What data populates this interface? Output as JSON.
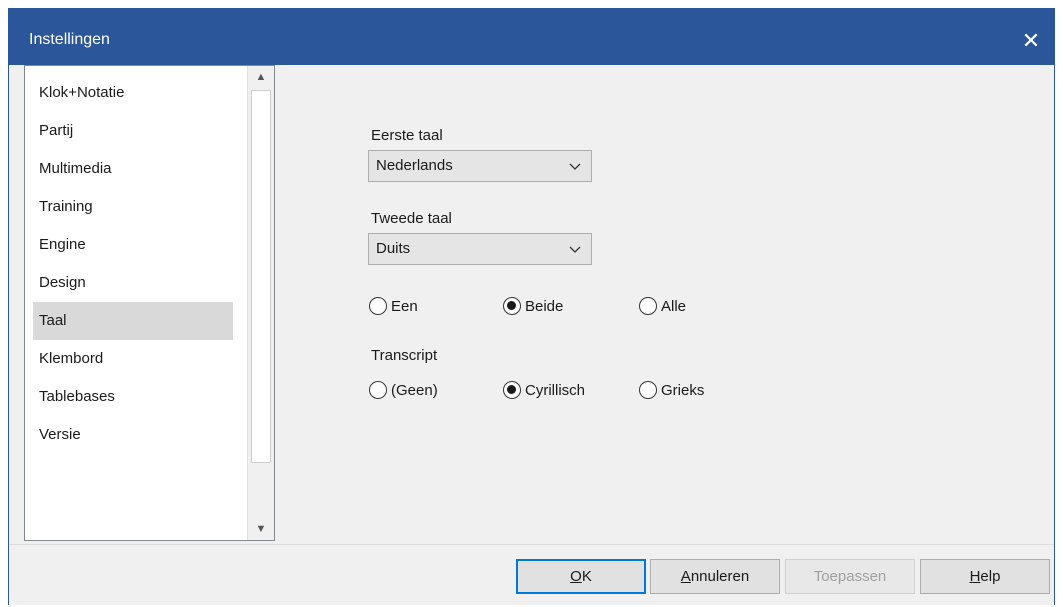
{
  "window": {
    "title": "Instellingen",
    "close_glyph": "✕"
  },
  "sidebar": {
    "items": [
      {
        "label": "Klok+Notatie"
      },
      {
        "label": "Partij"
      },
      {
        "label": "Multimedia"
      },
      {
        "label": "Training"
      },
      {
        "label": "Engine"
      },
      {
        "label": "Design"
      },
      {
        "label": "Taal",
        "selected": true
      },
      {
        "label": "Klembord"
      },
      {
        "label": "Tablebases"
      },
      {
        "label": "Versie"
      }
    ],
    "scroll_up_glyph": "▲",
    "scroll_down_glyph": "▼"
  },
  "language": {
    "first_label": "Eerste taal",
    "first_value": "Nederlands",
    "second_label": "Tweede taal",
    "second_value": "Duits",
    "scope_options": [
      {
        "label": "Een",
        "checked": false
      },
      {
        "label": "Beide",
        "checked": true
      },
      {
        "label": "Alle",
        "checked": false
      }
    ],
    "transcript_label": "Transcript",
    "transcript_options": [
      {
        "label": "(Geen)",
        "checked": false
      },
      {
        "label": "Cyrillisch",
        "checked": true
      },
      {
        "label": "Grieks",
        "checked": false
      }
    ]
  },
  "buttons": {
    "ok": {
      "label_accel": "O",
      "label_rest": "K"
    },
    "cancel": {
      "label_accel": "A",
      "label_rest": "nnuleren"
    },
    "apply": {
      "label": "Toepassen",
      "disabled": true
    },
    "help": {
      "label_accel": "H",
      "label_rest": "elp"
    }
  },
  "colors": {
    "titlebar": "#2b579a",
    "selected_item": "#d9d9d9",
    "default_button_border": "#0078d7"
  }
}
